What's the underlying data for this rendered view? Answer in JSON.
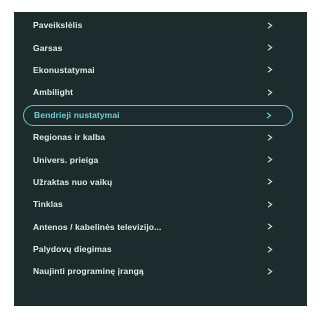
{
  "menu": {
    "items": [
      {
        "label": "Paveikslėlis",
        "selected": false
      },
      {
        "label": "Garsas",
        "selected": false
      },
      {
        "label": "Ekonustatymai",
        "selected": false
      },
      {
        "label": "Ambilight",
        "selected": false
      },
      {
        "label": "Bendrieji nustatymai",
        "selected": true
      },
      {
        "label": "Regionas ir kalba",
        "selected": false
      },
      {
        "label": "Univers. prieiga",
        "selected": false
      },
      {
        "label": "Užraktas nuo vaikų",
        "selected": false
      },
      {
        "label": "Tinklas",
        "selected": false
      },
      {
        "label": "Antenos / kabelinės televizijo...",
        "selected": false
      },
      {
        "label": "Palydovų diegimas",
        "selected": false
      },
      {
        "label": "Naujinti programinę įrangą",
        "selected": false
      }
    ],
    "chevron_icon": "chevron-right-icon"
  },
  "colors": {
    "panel_background": "#1c2b2b",
    "text": "#e3e9e9",
    "selected_accent": "#5fc4d4"
  }
}
